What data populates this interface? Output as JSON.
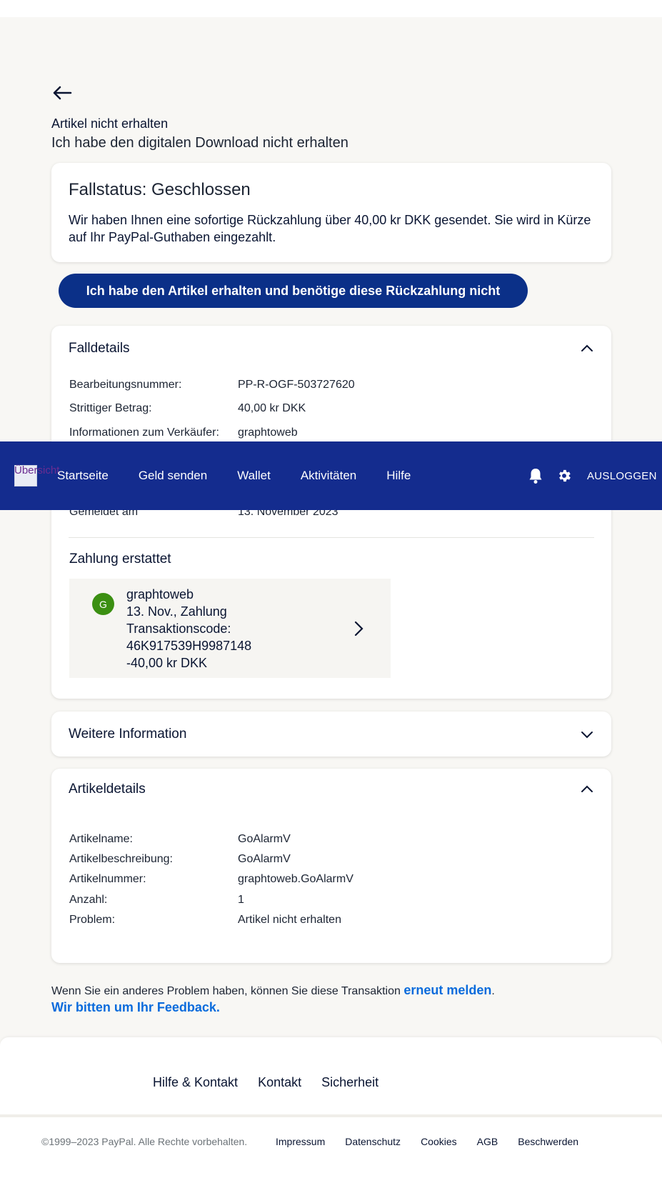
{
  "header": {
    "breadcrumb": "Artikel nicht erhalten",
    "subtitle": "Ich habe den digitalen Download nicht erhalten"
  },
  "status": {
    "title": "Fallstatus: Geschlossen",
    "text": "Wir haben Ihnen eine sofortige Rückzahlung über 40,00 kr DKK gesendet. Sie wird in Kürze auf Ihr PayPal-Guthaben eingezahlt."
  },
  "primary_button": "Ich habe den Artikel erhalten und benötige diese Rückzahlung nicht",
  "case_details": {
    "title": "Falldetails",
    "rows": [
      {
        "label": "Bearbeitungsnummer:",
        "value": "PP-R-OGF-503727620"
      },
      {
        "label": "Strittiger Betrag:",
        "value": "40,00 kr DKK"
      },
      {
        "label": "Informationen zum Verkäufer:",
        "value": "graphtoweb"
      },
      {
        "label": "Gemeldet am",
        "value": "13. November 2023"
      }
    ],
    "payment_heading": "Zahlung erstattet",
    "transaction": {
      "avatar_initial": "G",
      "merchant": "graphtoweb",
      "date_type": "13. Nov., Zahlung",
      "code_label": "Transaktionscode:",
      "code": "46K917539H9987148",
      "amount": "-40,00 kr DKK"
    }
  },
  "more_info": {
    "title": "Weitere Information"
  },
  "article_details": {
    "title": "Artikeldetails",
    "rows": [
      {
        "label": "Artikelname:",
        "value": "GoAlarmV"
      },
      {
        "label": "Artikelbeschreibung:",
        "value": "GoAlarmV"
      },
      {
        "label": "Artikelnummer:",
        "value": "graphtoweb.GoAlarmV"
      },
      {
        "label": "Anzahl:",
        "value": "1"
      },
      {
        "label": "Problem:",
        "value": "Artikel nicht erhalten"
      }
    ]
  },
  "note": {
    "prefix": "Wenn Sie ein anderes Problem haben, können Sie diese Transaktion ",
    "link": "erneut melden",
    "suffix": ".",
    "feedback": "Wir bitten um Ihr Feedback."
  },
  "footer": {
    "links": [
      "Hilfe & Kontakt",
      "Kontakt",
      "Sicherheit"
    ],
    "copyright": "©1999–2023 PayPal. Alle Rechte vorbehalten.",
    "legal": [
      "Impressum",
      "Datenschutz",
      "Cookies",
      "AGB",
      "Beschwerden"
    ]
  },
  "nav": {
    "logo_text": "Übersicht",
    "items": [
      "Startseite",
      "Geld senden",
      "Wallet",
      "Aktivitäten",
      "Hilfe"
    ],
    "logout": "AUSLOGGEN"
  },
  "colors": {
    "nav_bg": "#142c8e",
    "button_bg": "#0b3088",
    "link": "#0a6bdc",
    "avatar": "#3b8f12"
  }
}
